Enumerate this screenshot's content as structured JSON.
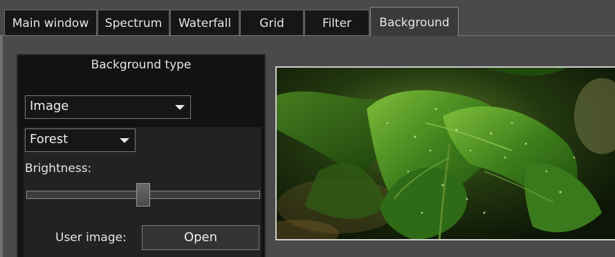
{
  "tabs": [
    {
      "label": "Main window"
    },
    {
      "label": "Spectrum"
    },
    {
      "label": "Waterfall"
    },
    {
      "label": "Grid"
    },
    {
      "label": "Filter"
    },
    {
      "label": "Background",
      "active": true
    }
  ],
  "panel": {
    "title": "Background type",
    "type_select": {
      "value": "Image"
    },
    "image_select": {
      "value": "Forest"
    },
    "brightness_label": "Brightness:",
    "brightness_value": 0.5,
    "user_image_label": "User image:",
    "open_button": "Open"
  },
  "preview": {
    "image_name": "Forest"
  },
  "colors": {
    "accent": "#e6e6e6",
    "panel_bg": "#121212",
    "window_bg": "#4a4a4a"
  }
}
